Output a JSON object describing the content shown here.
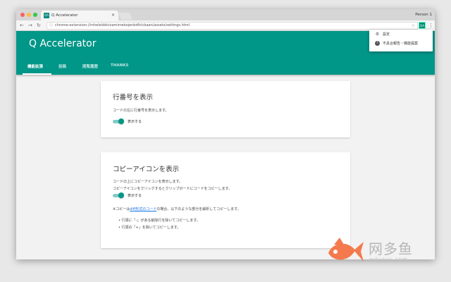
{
  "browser": {
    "tab_title": "Q Accelerator",
    "tab_favicon": "QA",
    "tab_close": "✕",
    "person": "Person 1",
    "url": "chrome-extension://mhelelddcioamimekojenbdfclcbaan/assets/settings.html",
    "extension_badge": "QA"
  },
  "app": {
    "title": "Q Accelerator",
    "accent_color": "#009688",
    "tabs": [
      {
        "label": "機能拡張",
        "active": true
      },
      {
        "label": "投稿",
        "active": false
      },
      {
        "label": "閲覧履歴",
        "active": false
      },
      {
        "label": "THANKS",
        "active": false
      }
    ]
  },
  "popup": {
    "items": [
      {
        "label": "設定",
        "icon": "gear-icon"
      },
      {
        "label": "不具合報告・機能提案",
        "icon": "info-icon"
      }
    ]
  },
  "cards": [
    {
      "title": "行番号を表示",
      "lines": [
        "コードの左に行番号を表示します。"
      ],
      "toggle_label": "表示する",
      "toggle_on": true
    },
    {
      "title": "コピーアイコンを表示",
      "lines": [
        "コードの上にコピーアイコンを表示します。",
        "コピーアイコンをクリックするとクリップボードにコードをコピーします。"
      ],
      "toggle_label": "表示する",
      "toggle_on": true,
      "note_prefix": "※コピーは",
      "note_link": "diff形式のコード",
      "note_suffix": "の場合、以下のような部分を解析してコピーします。",
      "bullets": [
        "行頭に「-」がある削除行を除いてコピーします。",
        "行頭の「+」を除いてコピーします。"
      ]
    }
  ],
  "watermark": {
    "text": "网多鱼",
    "sub": "wduoyu.com"
  }
}
